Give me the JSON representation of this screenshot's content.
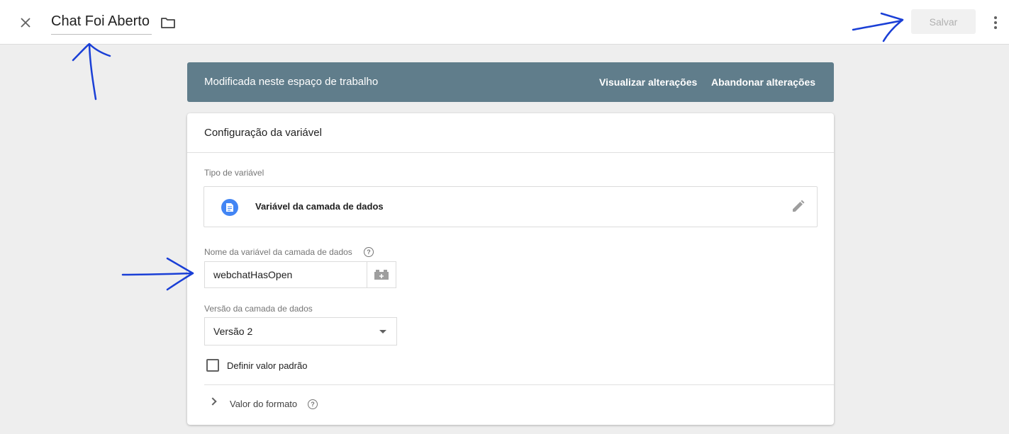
{
  "header": {
    "title": "Chat Foi Aberto",
    "save_label": "Salvar"
  },
  "banner": {
    "text": "Modificada neste espaço de trabalho",
    "view_changes": "Visualizar alterações",
    "discard_changes": "Abandonar alterações"
  },
  "card": {
    "title": "Configuração da variável",
    "type_label": "Tipo de variável",
    "type_name": "Variável da camada de dados",
    "name_label": "Nome da variável da camada de dados",
    "name_value": "webchatHasOpen",
    "version_label": "Versão da camada de dados",
    "version_value": "Versão 2",
    "default_checkbox_label": "Definir valor padrão",
    "format_label": "Valor do formato"
  },
  "icons": {
    "close": "close-icon",
    "folder": "folder-icon",
    "more": "more-vert-icon",
    "document": "document-icon",
    "edit": "pencil-icon",
    "help": "help-icon",
    "variable_picker": "variable-picker-icon",
    "chevron": "chevron-right-icon"
  },
  "colors": {
    "banner": "#607d8b",
    "type_icon": "#4285f4",
    "annotation": "#1a3fd6"
  }
}
